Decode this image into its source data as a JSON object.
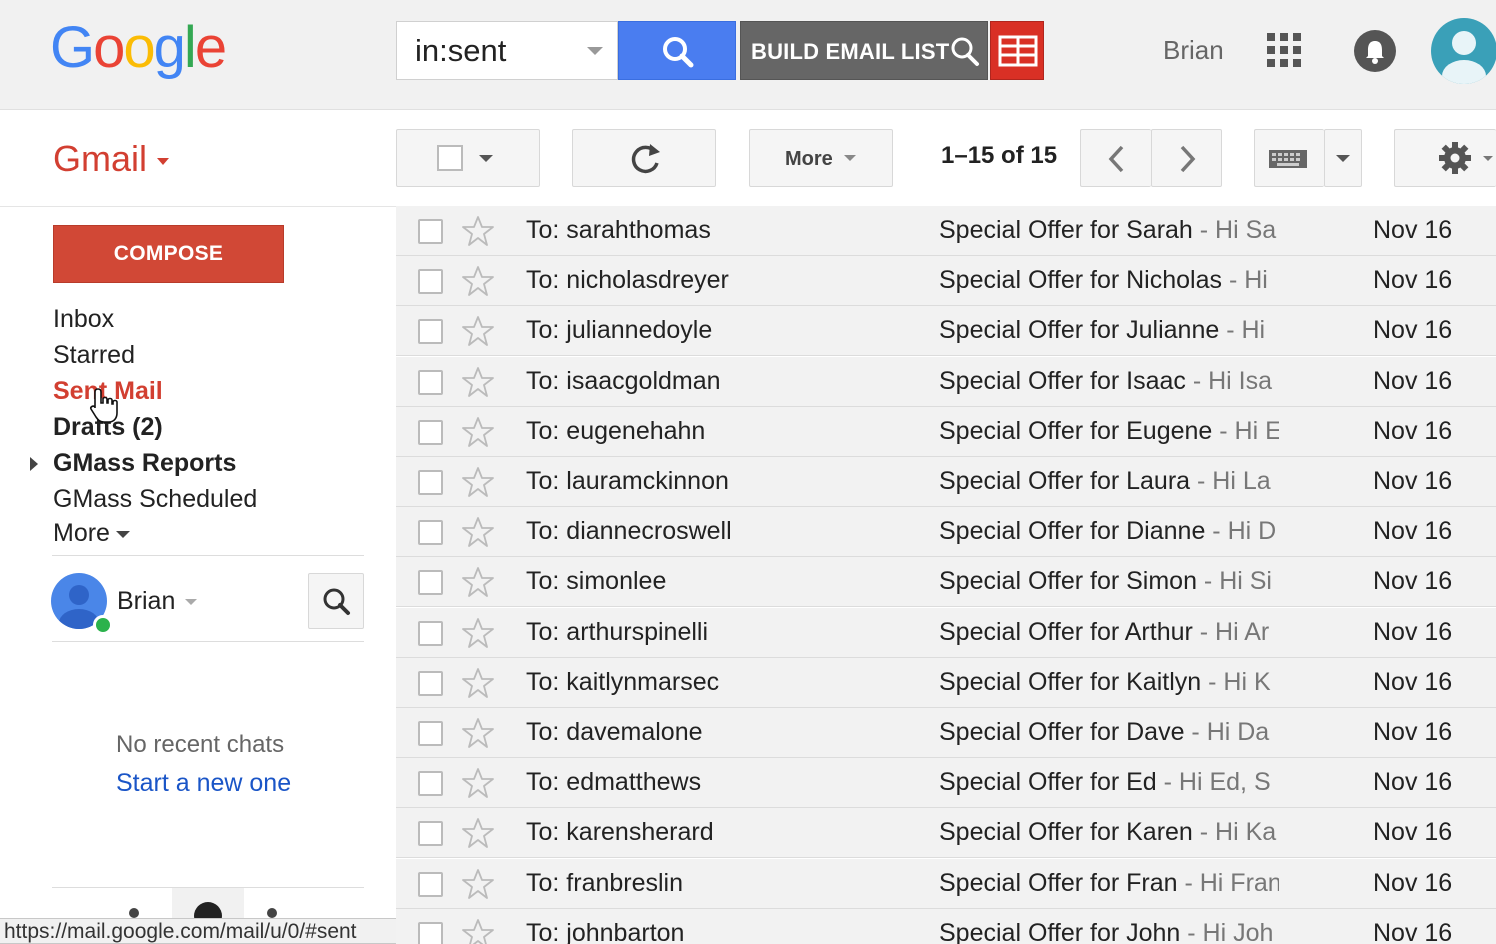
{
  "header": {
    "logo_letters": [
      {
        "ch": "G",
        "color": "#4285f4"
      },
      {
        "ch": "o",
        "color": "#ea4335"
      },
      {
        "ch": "o",
        "color": "#fbbc05"
      },
      {
        "ch": "g",
        "color": "#4285f4"
      },
      {
        "ch": "l",
        "color": "#34a853"
      },
      {
        "ch": "e",
        "color": "#ea4335"
      }
    ],
    "search_value": "in:sent",
    "build_label": "BUILD EMAIL LIST",
    "user_name": "Brian"
  },
  "toolbar": {
    "app_label": "Gmail",
    "more_label": "More",
    "page_count": "1–15 of 15"
  },
  "sidebar": {
    "compose_label": "COMPOSE",
    "items": [
      {
        "label": "Inbox",
        "style": "normal"
      },
      {
        "label": "Starred",
        "style": "normal"
      },
      {
        "label": "Sent Mail",
        "style": "active"
      },
      {
        "label": "Drafts (2)",
        "style": "bold"
      },
      {
        "label": "GMass Reports",
        "style": "bold"
      },
      {
        "label": "GMass Scheduled",
        "style": "normal"
      },
      {
        "label": "More",
        "style": "more"
      }
    ],
    "chat_user": "Brian",
    "no_chats": "No recent chats",
    "start_new": "Start a new one"
  },
  "status_url": "https://mail.google.com/mail/u/0/#sent",
  "emails": [
    {
      "to": "To: sarahthomas",
      "subject": "Special Offer for Sarah",
      "snippet": " - Hi Sa",
      "date": "Nov 16"
    },
    {
      "to": "To: nicholasdreyer",
      "subject": "Special Offer for Nicholas",
      "snippet": " - Hi",
      "date": "Nov 16"
    },
    {
      "to": "To: juliannedoyle",
      "subject": "Special Offer for Julianne",
      "snippet": " - Hi",
      "date": "Nov 16"
    },
    {
      "to": "To: isaacgoldman",
      "subject": "Special Offer for Isaac",
      "snippet": " - Hi Isa",
      "date": "Nov 16"
    },
    {
      "to": "To: eugenehahn",
      "subject": "Special Offer for Eugene",
      "snippet": " - Hi E",
      "date": "Nov 16"
    },
    {
      "to": "To: lauramckinnon",
      "subject": "Special Offer for Laura",
      "snippet": " - Hi La",
      "date": "Nov 16"
    },
    {
      "to": "To: diannecroswell",
      "subject": "Special Offer for Dianne",
      "snippet": " - Hi D",
      "date": "Nov 16"
    },
    {
      "to": "To: simonlee",
      "subject": "Special Offer for Simon",
      "snippet": " - Hi Si",
      "date": "Nov 16"
    },
    {
      "to": "To: arthurspinelli",
      "subject": "Special Offer for Arthur",
      "snippet": " - Hi Ar",
      "date": "Nov 16"
    },
    {
      "to": "To: kaitlynmarsec",
      "subject": "Special Offer for Kaitlyn",
      "snippet": " - Hi K",
      "date": "Nov 16"
    },
    {
      "to": "To: davemalone",
      "subject": "Special Offer for Dave",
      "snippet": " - Hi Da",
      "date": "Nov 16"
    },
    {
      "to": "To: edmatthews",
      "subject": "Special Offer for Ed",
      "snippet": " - Hi Ed, S",
      "date": "Nov 16"
    },
    {
      "to": "To: karensherard",
      "subject": "Special Offer for Karen",
      "snippet": " - Hi Ka",
      "date": "Nov 16"
    },
    {
      "to": "To: franbreslin",
      "subject": "Special Offer for Fran",
      "snippet": " - Hi Fran",
      "date": "Nov 16"
    },
    {
      "to": "To: johnbarton",
      "subject": "Special Offer for John",
      "snippet": " - Hi Joh",
      "date": "Nov 16"
    }
  ]
}
